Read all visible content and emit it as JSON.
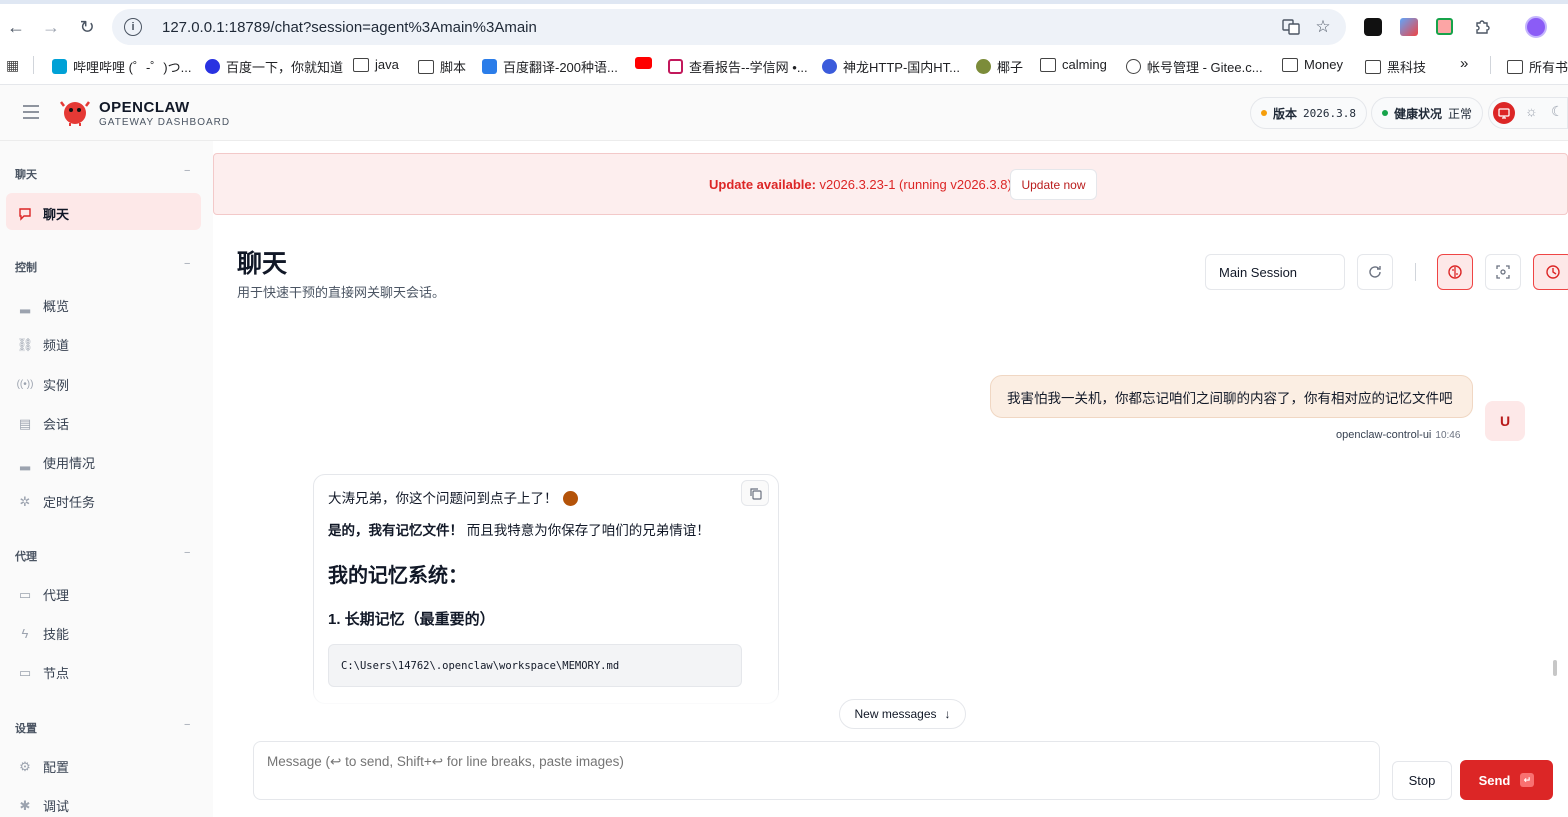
{
  "browser": {
    "url": "127.0.0.1:18789/chat?session=agent%3Amain%3Amain",
    "bookmarks": [
      {
        "label": "哔哩哔哩 (゜-゜)つ...",
        "color": "#00a1d6"
      },
      {
        "label": "百度一下，你就知道",
        "color": "#2932e1"
      },
      {
        "label": "java",
        "color": ""
      },
      {
        "label": "脚本",
        "color": ""
      },
      {
        "label": "百度翻译-200种语...",
        "color": "#2b7de9"
      },
      {
        "label": "",
        "color": "#ff0000"
      },
      {
        "label": "查看报告--学信网 •...",
        "color": "#c2185b"
      },
      {
        "label": "神龙HTTP-国内HT...",
        "color": "#3b5bdb"
      },
      {
        "label": "椰子",
        "color": "#7c8c3a"
      },
      {
        "label": "calming",
        "color": ""
      },
      {
        "label": "帐号管理 - Gitee.c...",
        "color": "#444444"
      },
      {
        "label": "Money",
        "color": ""
      },
      {
        "label": "黑科技",
        "color": ""
      },
      {
        "label": "所有书",
        "color": ""
      }
    ],
    "more": "»"
  },
  "header": {
    "brand": "OPENCLAW",
    "brand_sub": "GATEWAY DASHBOARD",
    "version_label": "版本",
    "version_value": "2026.3.8",
    "health_label": "健康状况",
    "health_value": "正常"
  },
  "sidebar": {
    "sections": [
      {
        "label": "聊天",
        "items": [
          "聊天"
        ]
      },
      {
        "label": "控制",
        "items": [
          "概览",
          "频道",
          "实例",
          "会话",
          "使用情况",
          "定时任务"
        ]
      },
      {
        "label": "代理",
        "items": [
          "代理",
          "技能",
          "节点"
        ]
      },
      {
        "label": "设置",
        "items": [
          "配置",
          "调试"
        ]
      }
    ],
    "collapse": "−"
  },
  "banner": {
    "prefix": "Update available:",
    "text": " v2026.3.23-1 (running v2026.3.8).",
    "button": "Update now"
  },
  "page": {
    "title": "聊天",
    "subtitle": "用于快速干预的直接网关聊天会话。",
    "session": "Main Session"
  },
  "messages": {
    "user": {
      "text": "我害怕我一关机，你都忘记咱们之间聊的内容了，你有相对应的记忆文件吧",
      "author": "openclaw-control-ui",
      "time": "10:46",
      "avatar": "U"
    },
    "assistant": {
      "line1": "大涛兄弟，你这个问题问到点子上了！",
      "line2_bold": "是的，我有记忆文件！",
      "line2_rest": " 而且我特意为你保存了咱们的兄弟情谊！",
      "heading": "我的记忆系统：",
      "subheading": "1. 长期记忆（最重要的）",
      "code": "C:\\Users\\14762\\.openclaw\\workspace\\MEMORY.md"
    }
  },
  "composer": {
    "new_messages": "New messages",
    "placeholder": "Message (↩ to send, Shift+↩ for line breaks, paste images)",
    "stop": "Stop",
    "send": "Send"
  },
  "colors": {
    "accent": "#dc2626",
    "banner_bg": "#fdeeee",
    "user_bubble": "#fbeee3"
  }
}
